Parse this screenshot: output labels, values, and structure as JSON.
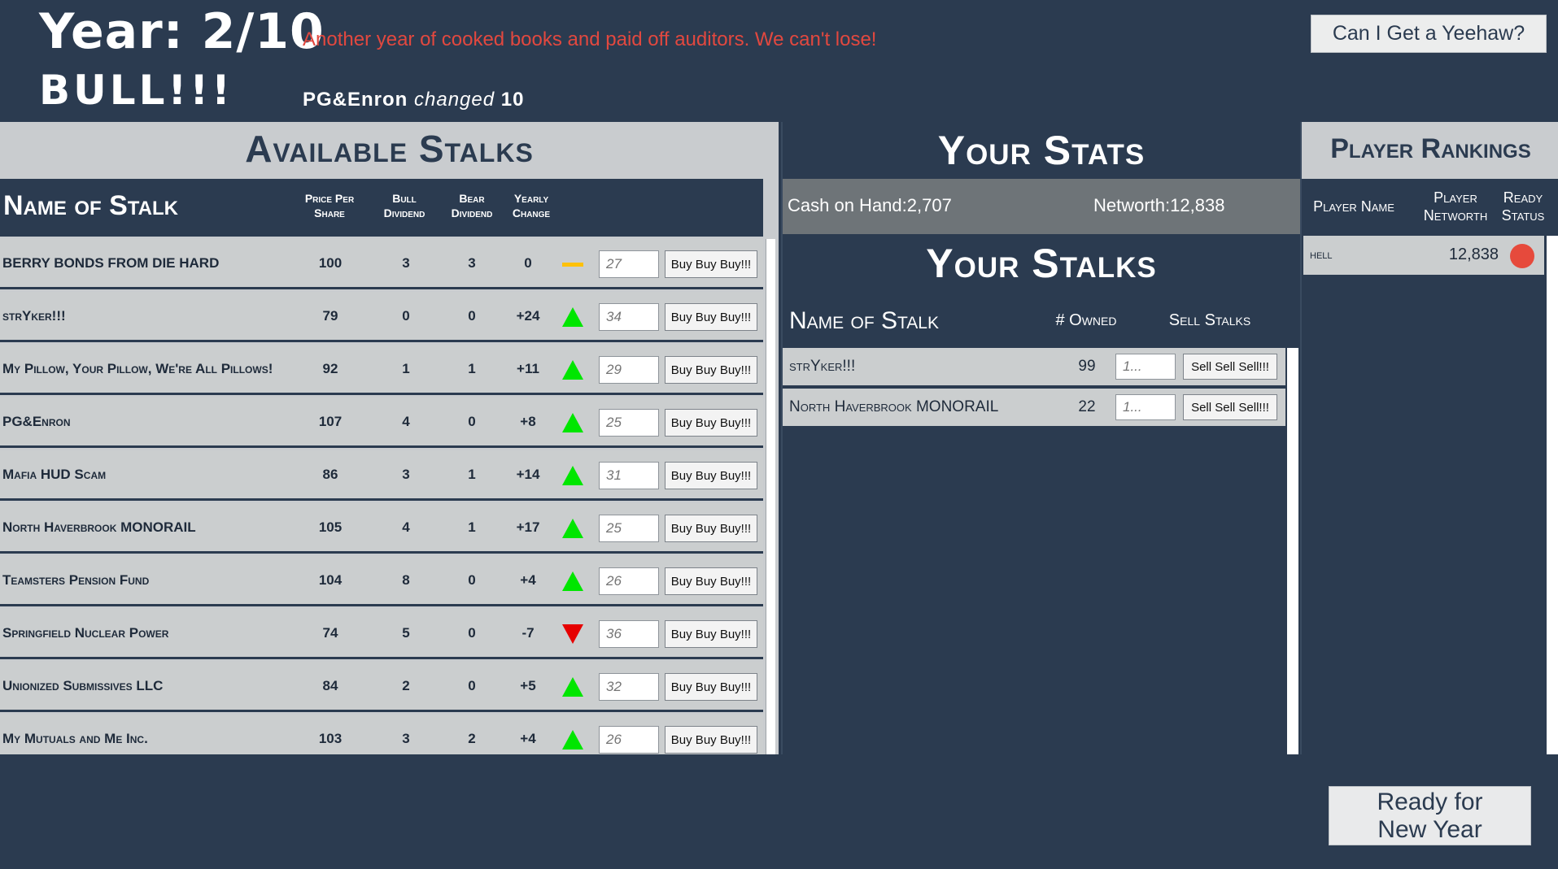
{
  "header": {
    "year_label": "Year: 2/10",
    "year_message": "Another year of cooked books and paid off auditors. We can't lose!",
    "market_mode": "BULL!!!",
    "change_stalk": "PG&Enron",
    "change_verb": "changed",
    "change_value": "10",
    "yeehaw_label": "Can I Get a Yeehaw?",
    "message_color": "#e2483f"
  },
  "available": {
    "title": "Available Stalks",
    "col_name": "Name of Stalk",
    "col_price": "Price Per Share",
    "col_bull": "Bull Dividend",
    "col_bear": "Bear Dividend",
    "col_change": "Yearly Change",
    "buy_label": "Buy Buy Buy!!!",
    "rows": [
      {
        "name": "BERRY BONDS FROM DIE HARD",
        "price": "100",
        "bull": "3",
        "bear": "3",
        "change": "0",
        "trend": "flat",
        "qty": "27"
      },
      {
        "name": "strYker!!!",
        "price": "79",
        "bull": "0",
        "bear": "0",
        "change": "+24",
        "trend": "up",
        "qty": "34"
      },
      {
        "name": "My Pillow, Your Pillow, We're All Pillows!",
        "price": "92",
        "bull": "1",
        "bear": "1",
        "change": "+11",
        "trend": "up",
        "qty": "29"
      },
      {
        "name": "PG&Enron",
        "price": "107",
        "bull": "4",
        "bear": "0",
        "change": "+8",
        "trend": "up",
        "qty": "25"
      },
      {
        "name": "Mafia HUD Scam",
        "price": "86",
        "bull": "3",
        "bear": "1",
        "change": "+14",
        "trend": "up",
        "qty": "31"
      },
      {
        "name": "North Haverbrook MONORAIL",
        "price": "105",
        "bull": "4",
        "bear": "1",
        "change": "+17",
        "trend": "up",
        "qty": "25"
      },
      {
        "name": "Teamsters Pension Fund",
        "price": "104",
        "bull": "8",
        "bear": "0",
        "change": "+4",
        "trend": "up",
        "qty": "26"
      },
      {
        "name": "Springfield Nuclear Power",
        "price": "74",
        "bull": "5",
        "bear": "0",
        "change": "-7",
        "trend": "down",
        "qty": "36"
      },
      {
        "name": "Unionized Submissives LLC",
        "price": "84",
        "bull": "2",
        "bear": "0",
        "change": "+5",
        "trend": "up",
        "qty": "32"
      },
      {
        "name": "My Mutuals and Me Inc.",
        "price": "103",
        "bull": "3",
        "bear": "2",
        "change": "+4",
        "trend": "up",
        "qty": "26"
      }
    ]
  },
  "stats": {
    "title": "Your Stats",
    "cash_label": "Cash on Hand:2,707",
    "networth_label": "Networth:12,838",
    "stalks_title": "Your Stalks",
    "col_name": "Name of Stalk",
    "col_owned": "# Owned",
    "col_sell": "Sell Stalks",
    "sell_label": "Sell Sell Sell!!!",
    "sell_placeholder": "1...",
    "owned": [
      {
        "name": "strYker!!!",
        "owned": "99"
      },
      {
        "name": "North Haverbrook MONORAIL",
        "owned": "22"
      }
    ]
  },
  "rankings": {
    "title": "Player Rankings",
    "col_name": "Player Name",
    "col_networth": "Player Networth",
    "col_ready": "Ready Status",
    "players": [
      {
        "name": "hell",
        "networth": "12,838",
        "ready_color": "#e64a3c"
      }
    ]
  },
  "footer": {
    "ready_label": "Ready for New Year"
  },
  "colors": {
    "background": "#2b3b50",
    "panel_light": "#c9cccf",
    "trend_up": "#00e600",
    "trend_down": "#e60000",
    "trend_flat": "#ffc107"
  }
}
